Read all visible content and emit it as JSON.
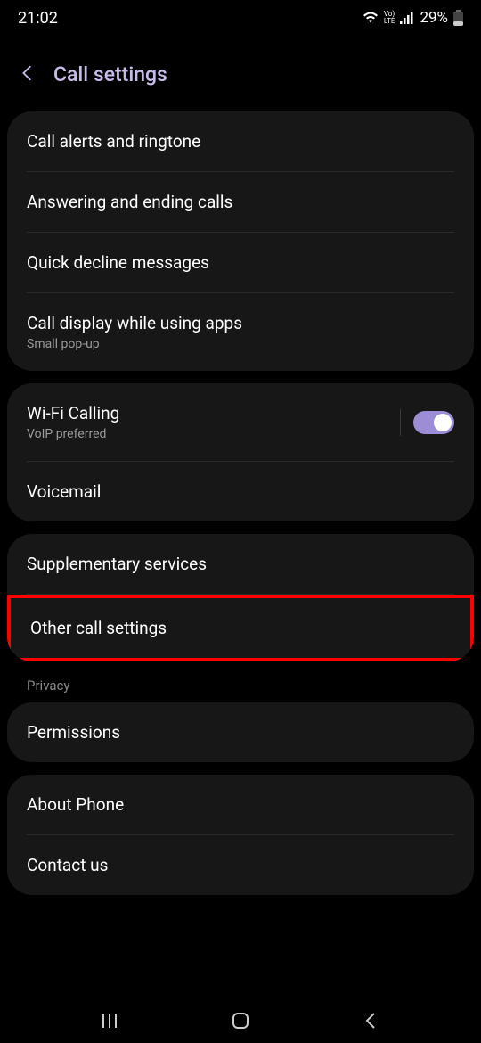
{
  "status": {
    "time": "21:02",
    "battery": "29%"
  },
  "header": {
    "title": "Call settings"
  },
  "groups": [
    {
      "items": [
        {
          "title": "Call alerts and ringtone"
        },
        {
          "title": "Answering and ending calls"
        },
        {
          "title": "Quick decline messages"
        },
        {
          "title": "Call display while using apps",
          "subtitle": "Small pop-up"
        }
      ]
    },
    {
      "items": [
        {
          "title": "Wi-Fi Calling",
          "subtitle": "VoIP preferred",
          "toggle": true
        },
        {
          "title": "Voicemail"
        }
      ]
    },
    {
      "items": [
        {
          "title": "Supplementary services"
        },
        {
          "title": "Other call settings",
          "highlight": true
        }
      ]
    }
  ],
  "privacy": {
    "label": "Privacy",
    "items": [
      {
        "title": "Permissions"
      }
    ]
  },
  "about": {
    "items": [
      {
        "title": "About Phone"
      },
      {
        "title": "Contact us"
      }
    ]
  }
}
